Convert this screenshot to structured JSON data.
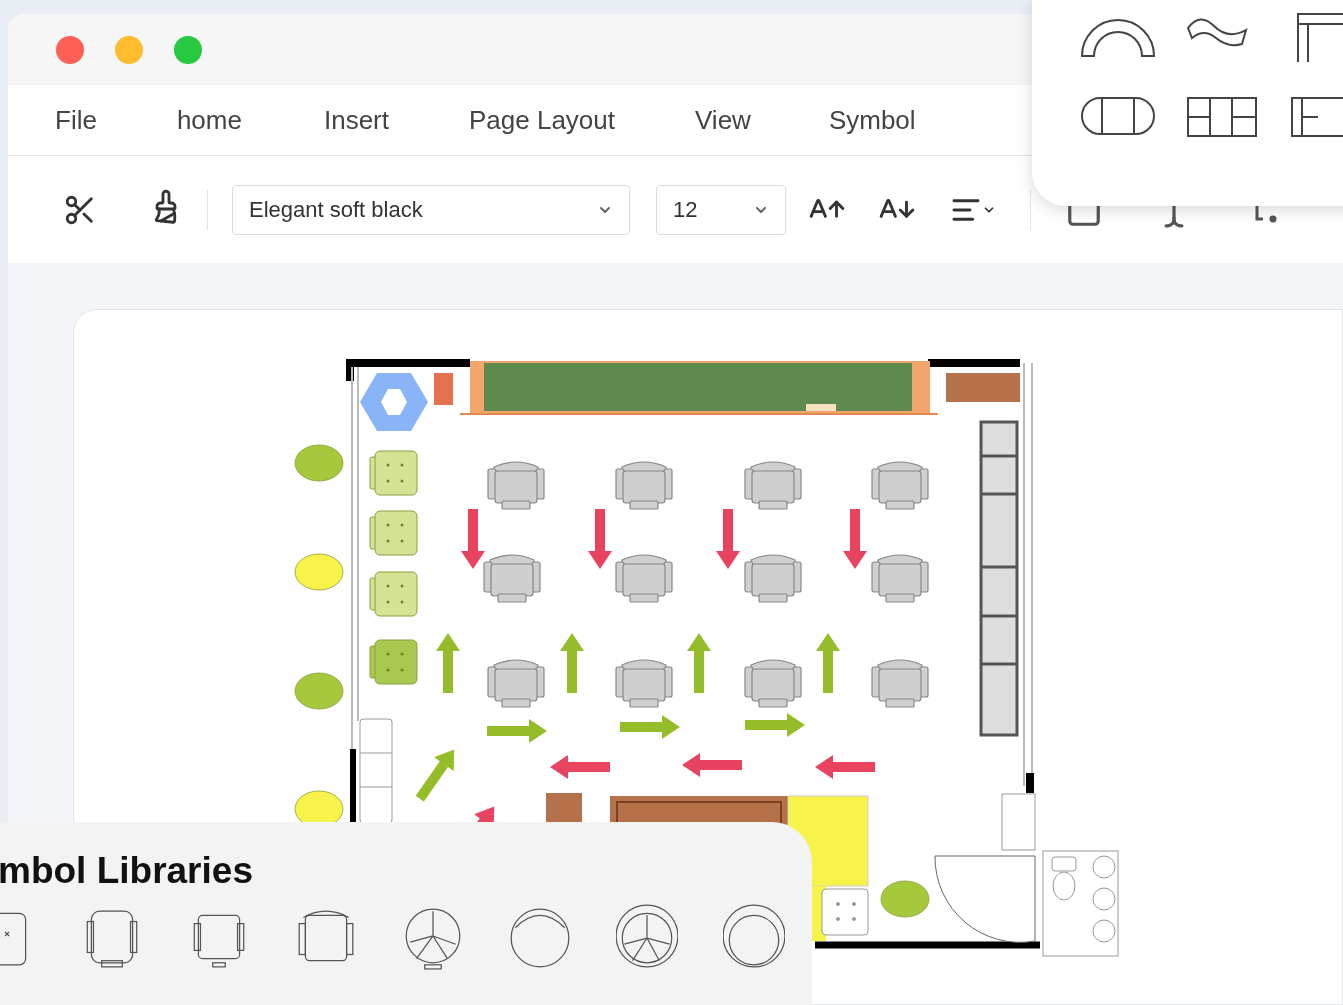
{
  "window": {
    "controls": [
      {
        "kind": "close"
      },
      {
        "kind": "minimize"
      },
      {
        "kind": "zoom"
      }
    ]
  },
  "menu": [
    "File",
    "home",
    "Insert",
    "Page Layout",
    "View",
    "Symbol"
  ],
  "toolbar": {
    "font": "Elegant soft black",
    "size": "12"
  },
  "symbol_libraries": {
    "title": "mbol Libraries"
  }
}
